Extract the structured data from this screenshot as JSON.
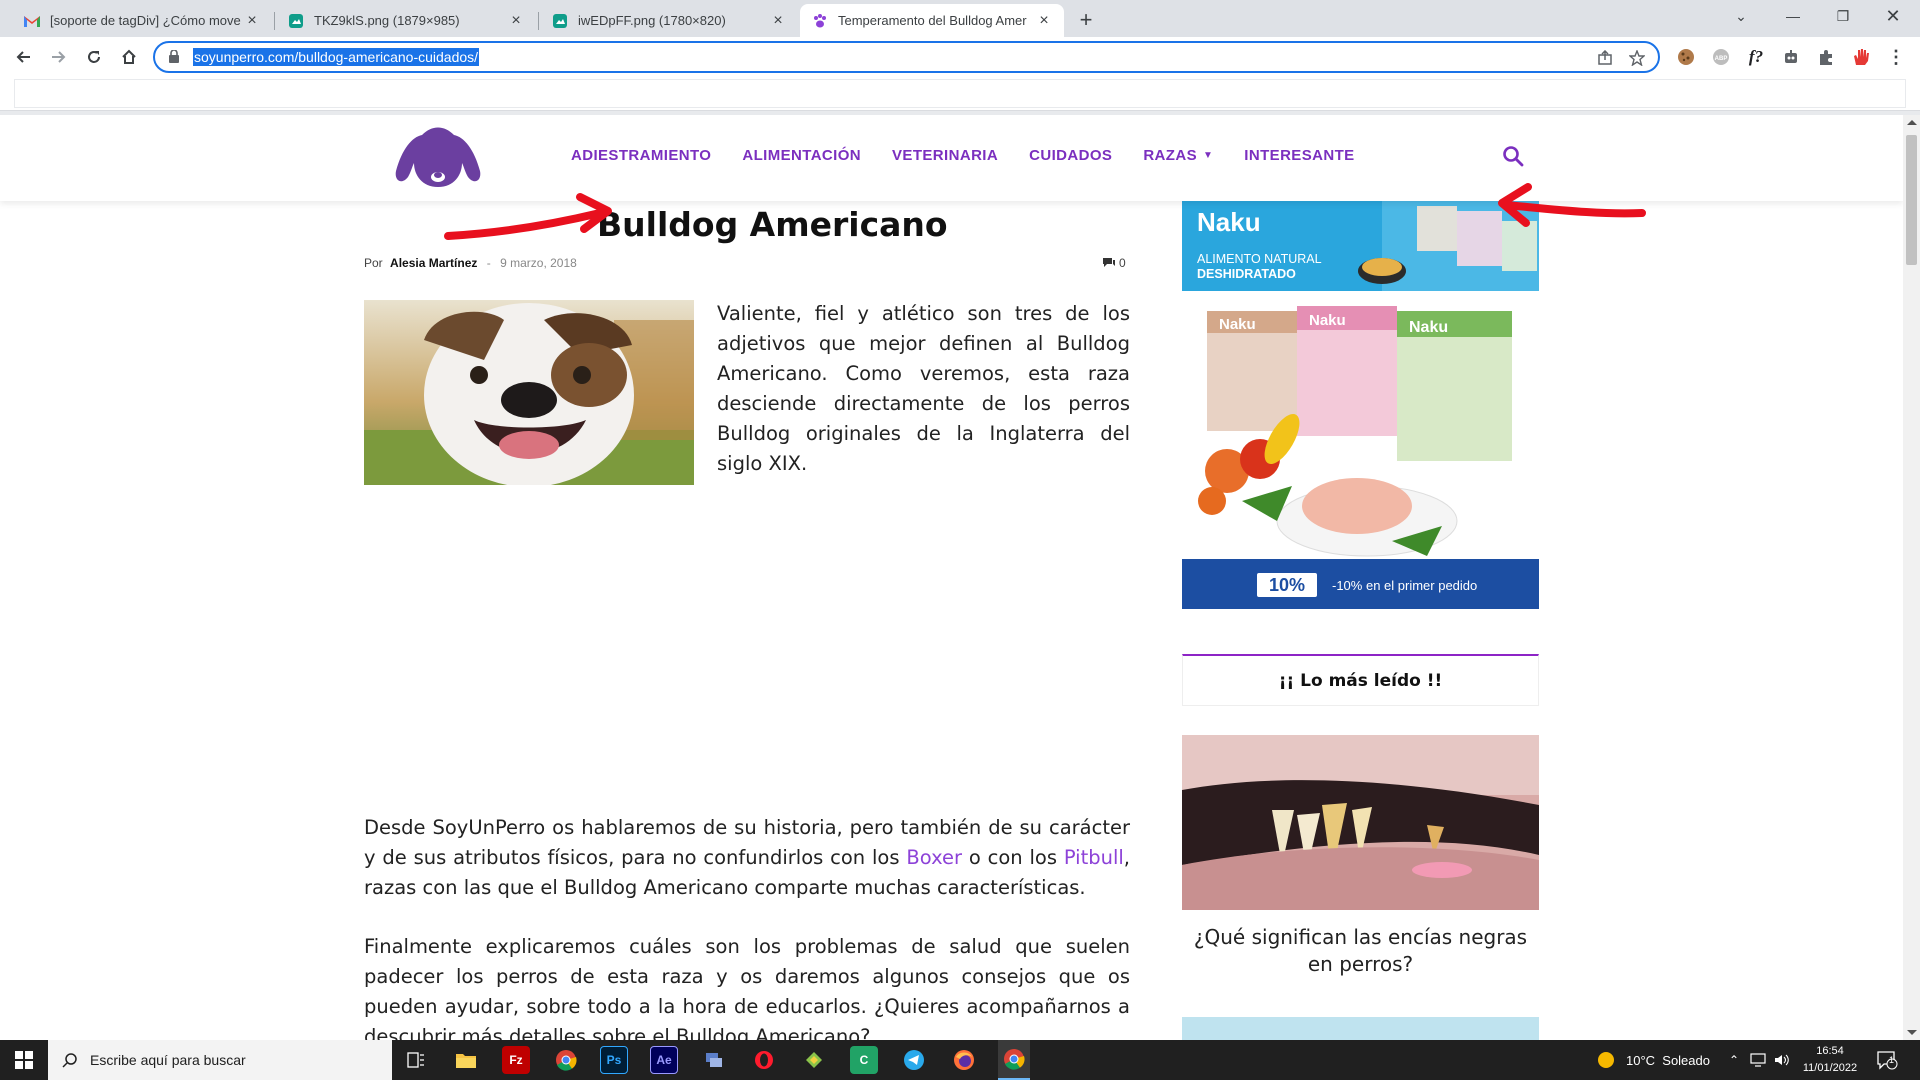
{
  "browser": {
    "tabs": [
      {
        "title": "[soporte de tagDiv] ¿Cómo move",
        "icon": "gmail-icon"
      },
      {
        "title": "TKZ9klS.png (1879×985)",
        "icon": "image-viewer-icon"
      },
      {
        "title": "iwEDpFF.png (1780×820)",
        "icon": "image-viewer-icon"
      },
      {
        "title": "Temperamento del Bulldog Amer",
        "icon": "paw-icon"
      }
    ],
    "url": "soyunperro.com/bulldog-americano-cuidados/"
  },
  "site": {
    "nav": [
      "ADIESTRAMIENTO",
      "ALIMENTACIÓN",
      "VETERINARIA",
      "CUIDADOS",
      "RAZAS",
      "INTERESANTE"
    ],
    "accent_color": "#7b2fbf"
  },
  "article": {
    "title": "Bulldog Americano",
    "by": "Por",
    "author": "Alesia Martínez",
    "date": "9 marzo, 2018",
    "comments": "0",
    "intro": "Valiente, fiel y atlético son tres de los adjetivos que mejor definen al Bulldog Americano. Como veremos, esta raza desciende directamente de los perros Bulldog originales de la Inglaterra del siglo XIX.",
    "p2_a": "Desde SoyUnPerro os hablaremos de su historia, pero también de su carácter y de sus atributos físicos, para no confundirlos con los ",
    "p2_link1": "Boxer",
    "p2_b": " o con los ",
    "p2_link2": "Pitbull",
    "p2_c": ", razas con las que el Bulldog Americano comparte muchas características.",
    "p3": "Finalmente explicaremos cuáles son los problemas de salud que suelen padecer los perros de esta raza y os daremos algunos consejos que os pueden ayudar, sobre todo a la hora de educarlos. ¿Quieres acompañarnos a descubrir más detalles sobre el Bulldog Americano?"
  },
  "sidebar": {
    "ad": {
      "brand": "Naku",
      "tagline1": "ALIMENTO NATURAL",
      "tagline2": "DESHIDRATADO",
      "box_labels": [
        "Naku",
        "Naku",
        "Naku"
      ],
      "discount_badge": "10%",
      "discount_text": "-10% en el primer pedido"
    },
    "widget_title": "¡¡ Lo más leído !!",
    "post_title": "¿Qué significan las encías negras en perros?"
  },
  "taskbar": {
    "search_placeholder": "Escribe aquí para buscar",
    "weather": "10°C  Soleado",
    "time": "16:54",
    "date": "11/01/2022",
    "notification_count": "1"
  }
}
